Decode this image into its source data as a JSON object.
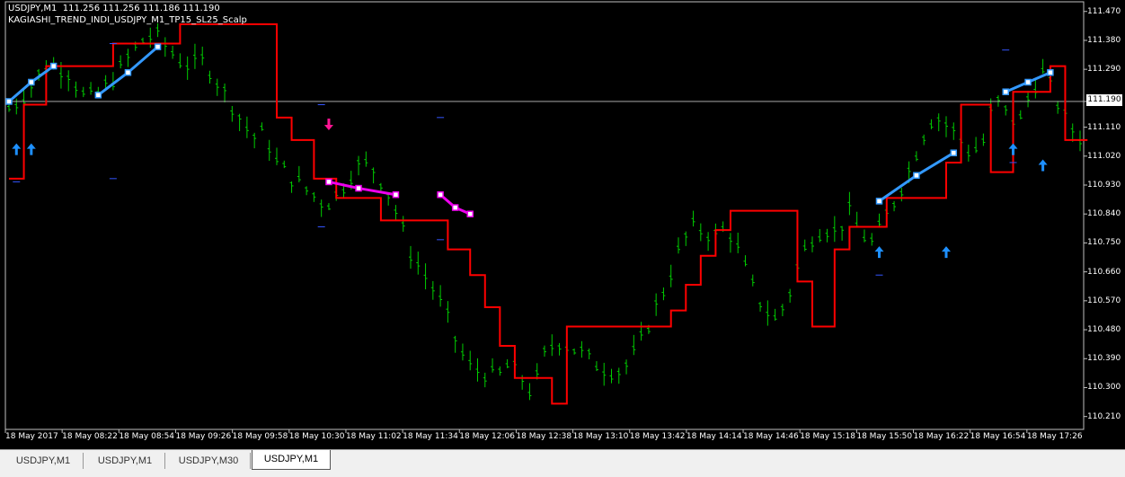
{
  "header": {
    "symbol_line": "USDJPY,M1  111.256 111.256 111.186 111.190",
    "indicator_line": "KAGIASHI_TREND_INDI_USDJPY_M1_TP15_SL25_Scalp"
  },
  "current_price_label": "111.190",
  "tabs": [
    {
      "label": "USDJPY,M1",
      "active": false
    },
    {
      "label": "USDJPY,M1",
      "active": false
    },
    {
      "label": "USDJPY,M30",
      "active": false
    },
    {
      "label": "USDJPY,M1",
      "active": true
    }
  ],
  "colors": {
    "background": "#000000",
    "price_bars": "#00cc00",
    "trend_line": "#ff0000",
    "buy_arrow": "#1e90ff",
    "sell_arrow": "#ff1493",
    "buy_signal_line": "#3399ff",
    "sell_signal_line": "#ee00ee",
    "current_price_line": "#c0c0c0"
  },
  "chart_data": {
    "type": "line",
    "title": "",
    "ylim": [
      110.17,
      111.5
    ],
    "y_ticks": [
      "111.470",
      "111.380",
      "111.290",
      "111.190",
      "111.110",
      "111.020",
      "110.930",
      "110.840",
      "110.750",
      "110.660",
      "110.570",
      "110.480",
      "110.390",
      "110.300",
      "110.210"
    ],
    "x_ticks": [
      "18 May 2017",
      "18 May 08:22",
      "18 May 08:54",
      "18 May 09:26",
      "18 May 09:58",
      "18 May 10:30",
      "18 May 11:02",
      "18 May 11:34",
      "18 May 12:06",
      "18 May 12:38",
      "18 May 13:10",
      "18 May 13:42",
      "18 May 14:14",
      "18 May 14:46",
      "18 May 15:18",
      "18 May 15:50",
      "18 May 16:22",
      "18 May 16:54",
      "18 May 17:26"
    ],
    "current_price": 111.19,
    "price_series": {
      "name": "",
      "values": [
        111.17,
        111.2,
        111.25,
        111.3,
        111.3,
        111.28,
        111.21,
        111.2,
        111.24,
        111.28,
        111.34,
        111.38,
        111.4,
        111.36,
        111.32,
        111.3,
        111.32,
        111.26,
        111.2,
        111.14,
        111.08,
        111.09,
        111.0,
        110.96,
        110.93,
        110.9,
        110.87,
        110.9,
        110.96,
        111.0,
        110.98,
        110.92,
        110.83,
        110.72,
        110.66,
        110.6,
        110.52,
        110.42,
        110.36,
        110.35,
        110.33,
        110.37,
        110.34,
        110.28,
        110.4,
        110.45,
        110.43,
        110.41,
        110.38,
        110.36,
        110.35,
        110.38,
        110.45,
        110.54,
        110.62,
        110.72,
        110.8,
        110.79,
        110.77,
        110.8,
        110.72,
        110.62,
        110.55,
        110.51,
        110.58,
        110.7,
        110.77,
        110.8,
        110.78,
        110.85,
        110.78,
        110.75,
        110.83,
        110.9,
        110.98,
        111.08,
        111.15,
        111.12,
        111.08,
        111.03,
        111.06,
        111.2,
        111.15,
        111.12,
        111.23,
        111.28,
        111.2,
        111.12,
        111.08
      ]
    },
    "trend_line": [
      [
        0,
        110.95
      ],
      [
        2,
        110.95
      ],
      [
        2,
        111.18
      ],
      [
        5,
        111.18
      ],
      [
        5,
        111.3
      ],
      [
        14,
        111.3
      ],
      [
        14,
        111.37
      ],
      [
        23,
        111.37
      ],
      [
        23,
        111.43
      ],
      [
        36,
        111.43
      ],
      [
        36,
        111.14
      ],
      [
        38,
        111.14
      ],
      [
        38,
        111.07
      ],
      [
        41,
        111.07
      ],
      [
        41,
        110.95
      ],
      [
        44,
        110.95
      ],
      [
        44,
        110.89
      ],
      [
        50,
        110.89
      ],
      [
        50,
        110.82
      ],
      [
        59,
        110.82
      ],
      [
        59,
        110.73
      ],
      [
        62,
        110.73
      ],
      [
        62,
        110.65
      ],
      [
        64,
        110.65
      ],
      [
        64,
        110.55
      ],
      [
        66,
        110.55
      ],
      [
        66,
        110.43
      ],
      [
        68,
        110.43
      ],
      [
        68,
        110.33
      ],
      [
        73,
        110.33
      ],
      [
        73,
        110.25
      ],
      [
        75,
        110.25
      ],
      [
        75,
        110.49
      ],
      [
        89,
        110.49
      ],
      [
        89,
        110.54
      ],
      [
        91,
        110.54
      ],
      [
        91,
        110.62
      ],
      [
        93,
        110.62
      ],
      [
        93,
        110.71
      ],
      [
        95,
        110.71
      ],
      [
        95,
        110.79
      ],
      [
        97,
        110.79
      ],
      [
        97,
        110.85
      ],
      [
        106,
        110.85
      ],
      [
        106,
        110.63
      ],
      [
        108,
        110.63
      ],
      [
        108,
        110.49
      ],
      [
        111,
        110.49
      ],
      [
        111,
        110.73
      ],
      [
        113,
        110.73
      ],
      [
        113,
        110.8
      ],
      [
        118,
        110.8
      ],
      [
        118,
        110.89
      ],
      [
        126,
        110.89
      ],
      [
        126,
        111.0
      ],
      [
        128,
        111.0
      ],
      [
        128,
        111.18
      ],
      [
        132,
        111.18
      ],
      [
        132,
        110.97
      ],
      [
        135,
        110.97
      ],
      [
        135,
        111.22
      ],
      [
        140,
        111.22
      ],
      [
        140,
        111.3
      ],
      [
        142,
        111.3
      ],
      [
        142,
        111.07
      ],
      [
        145,
        111.07
      ]
    ],
    "buy_signal_lines": [
      [
        [
          0,
          111.19
        ],
        [
          3,
          111.25
        ],
        [
          6,
          111.3
        ]
      ],
      [
        [
          12,
          111.21
        ],
        [
          16,
          111.28
        ],
        [
          20,
          111.36
        ]
      ],
      [
        [
          117,
          110.88
        ],
        [
          122,
          110.96
        ],
        [
          127,
          111.03
        ]
      ],
      [
        [
          134,
          111.22
        ],
        [
          137,
          111.25
        ],
        [
          140,
          111.28
        ]
      ]
    ],
    "sell_signal_lines": [
      [
        [
          43,
          110.94
        ],
        [
          47,
          110.92
        ],
        [
          52,
          110.9
        ]
      ],
      [
        [
          58,
          110.9
        ],
        [
          60,
          110.86
        ],
        [
          62,
          110.84
        ]
      ]
    ],
    "buy_arrows": [
      [
        1,
        111.04
      ],
      [
        3,
        111.04
      ],
      [
        117,
        110.72
      ],
      [
        126,
        110.72
      ],
      [
        135,
        111.04
      ],
      [
        139,
        110.99
      ]
    ],
    "sell_arrows": [
      [
        43,
        111.12
      ]
    ],
    "short_markers": [
      [
        1,
        110.94
      ],
      [
        14,
        111.37
      ],
      [
        14,
        110.95
      ],
      [
        42,
        111.18
      ],
      [
        42,
        110.8
      ],
      [
        58,
        111.14
      ],
      [
        58,
        110.76
      ],
      [
        117,
        110.65
      ],
      [
        134,
        111.35
      ],
      [
        135,
        111.0
      ]
    ]
  }
}
